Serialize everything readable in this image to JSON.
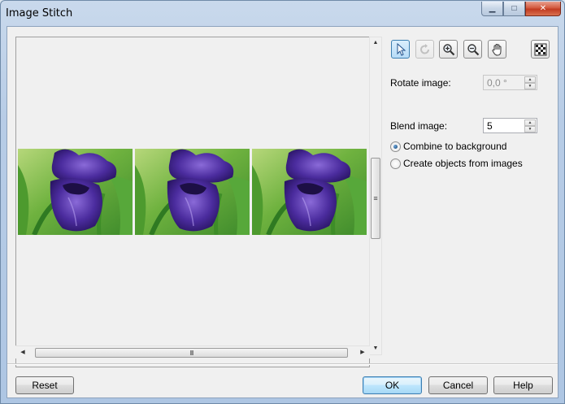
{
  "window": {
    "title": "Image Stitch",
    "minimize_icon": "minimize-icon",
    "maximize_icon": "maximize-icon",
    "close_icon": "close-icon"
  },
  "toolbar": {
    "tools": [
      {
        "name": "pick-tool",
        "icon": "pointer-arrow-icon",
        "state": "active"
      },
      {
        "name": "rotate-tool",
        "icon": "rotate-icon",
        "state": "disabled"
      },
      {
        "name": "zoom-in-tool",
        "icon": "zoom-in-icon",
        "state": "normal"
      },
      {
        "name": "zoom-out-tool",
        "icon": "zoom-out-icon",
        "state": "normal"
      },
      {
        "name": "pan-tool",
        "icon": "hand-icon",
        "state": "normal"
      },
      {
        "name": "transparency-tool",
        "icon": "checkerboard-icon",
        "state": "normal"
      }
    ]
  },
  "settings": {
    "rotate_label": "Rotate image:",
    "rotate_value": "0,0 °",
    "blend_label": "Blend image:",
    "blend_value": "5",
    "combine_label": "Combine to background",
    "create_objects_label": "Create objects from images",
    "selected_option": "combine"
  },
  "preview": {
    "images": [
      "iris-photo-1",
      "iris-photo-2",
      "iris-photo-3"
    ],
    "scroll_grip": "III",
    "colors": {
      "flower": "#4b2c9e",
      "leaf": "#4fa534",
      "background": "#7cc043"
    }
  },
  "buttons": {
    "reset": "Reset",
    "ok": "OK",
    "cancel": "Cancel",
    "help": "Help"
  }
}
